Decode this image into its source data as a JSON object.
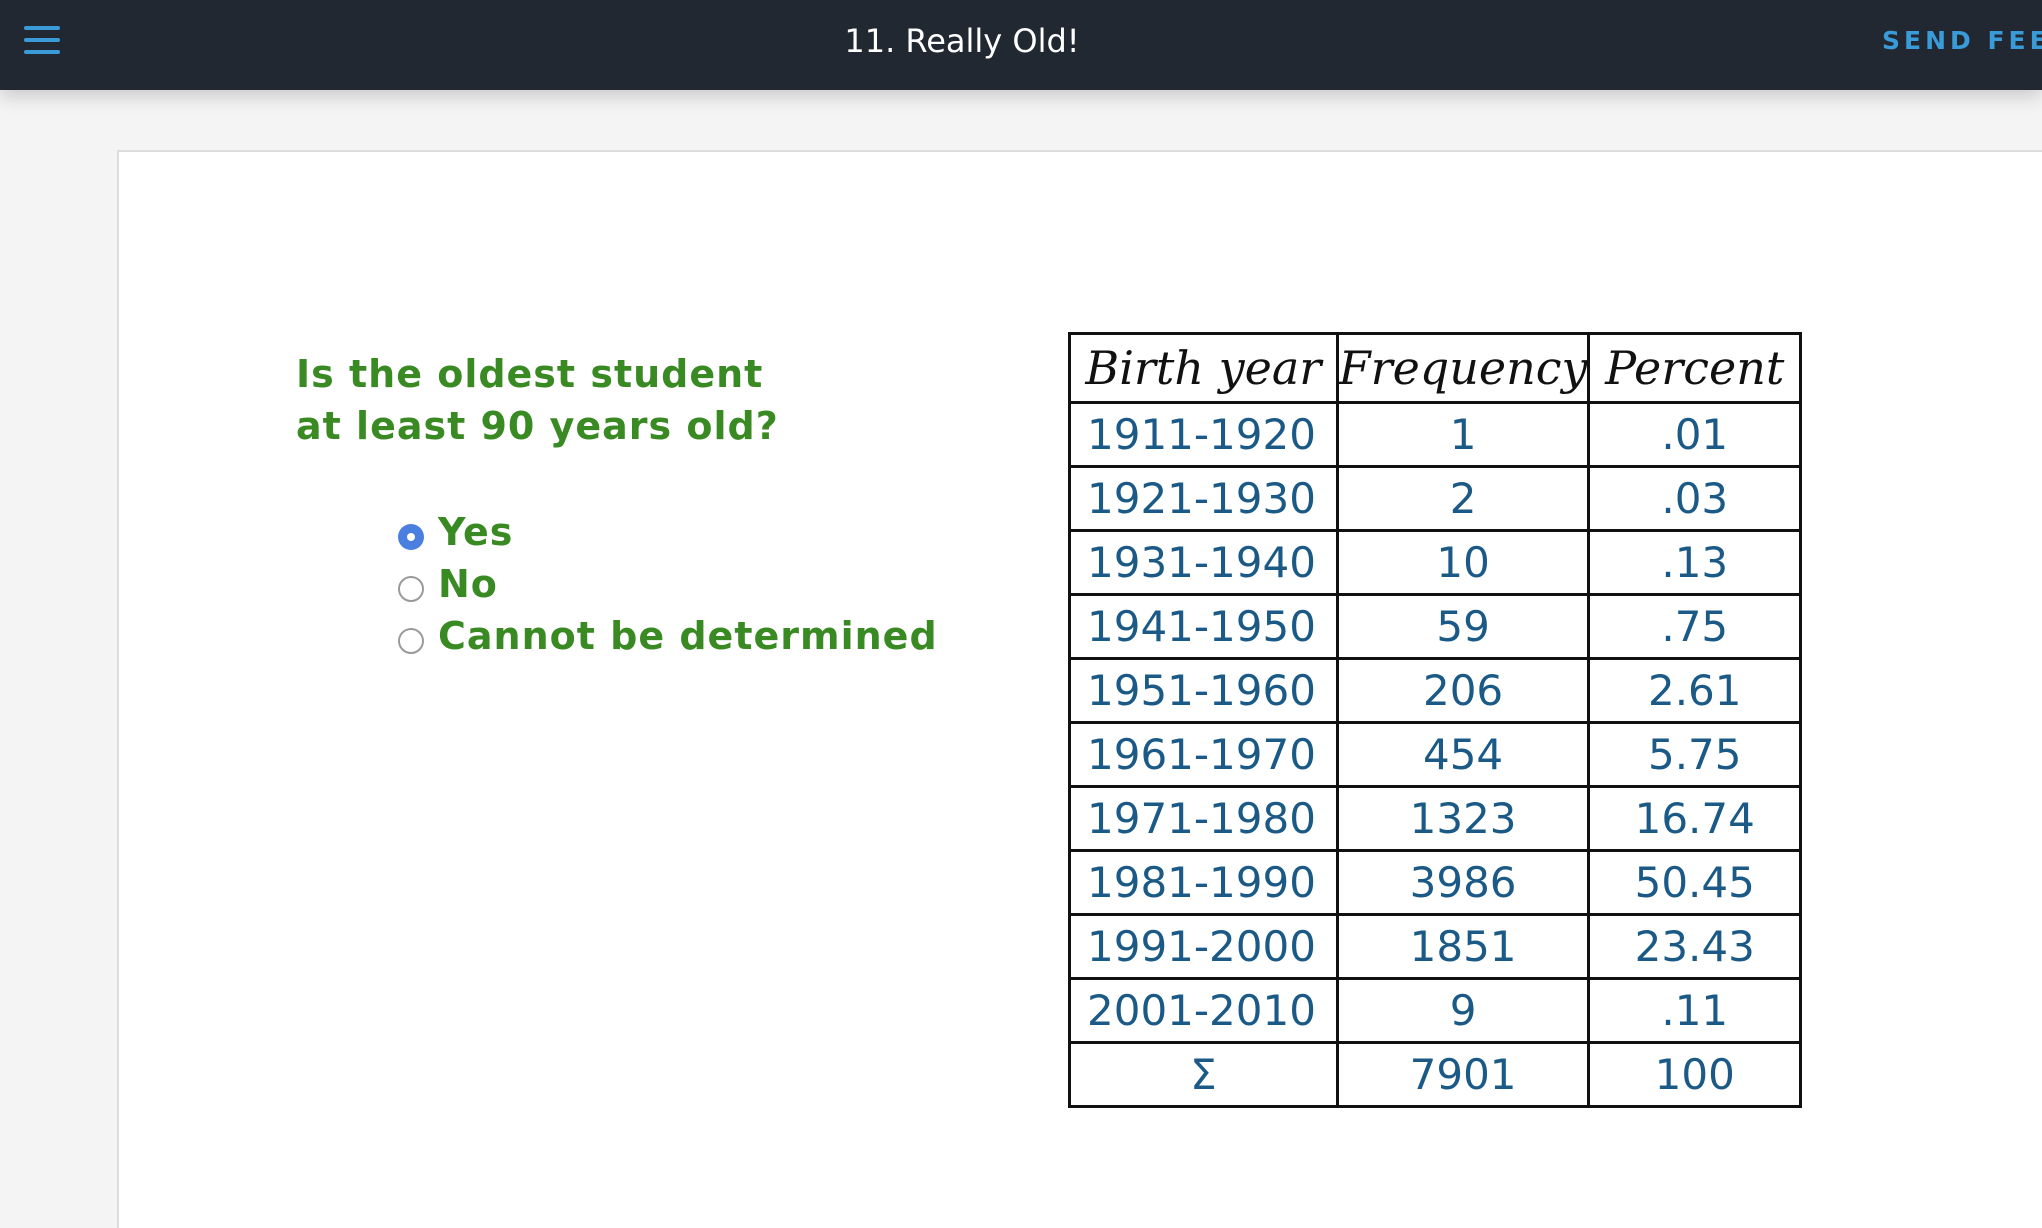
{
  "header": {
    "menu_icon": "hamburger-icon",
    "title": "11. Really Old!",
    "send_feedback_label": "SEND FEED",
    "accent_color": "#3a9bd9",
    "background_color": "#222831"
  },
  "question": {
    "line1": "Is the oldest student",
    "line2": "at least 90 years old?",
    "color": "#3a8a24",
    "options": [
      {
        "label": "Yes",
        "selected": true
      },
      {
        "label": "No",
        "selected": false
      },
      {
        "label": "Cannot be determined",
        "selected": false
      }
    ],
    "selected_color": "#4a7fe0"
  },
  "table": {
    "headers": [
      "Birth year",
      "Frequency",
      "Percent"
    ],
    "rows": [
      [
        "1911-1920",
        "1",
        ".01"
      ],
      [
        "1921-1930",
        "2",
        ".03"
      ],
      [
        "1931-1940",
        "10",
        ".13"
      ],
      [
        "1941-1950",
        "59",
        ".75"
      ],
      [
        "1951-1960",
        "206",
        "2.61"
      ],
      [
        "1961-1970",
        "454",
        "5.75"
      ],
      [
        "1971-1980",
        "1323",
        "16.74"
      ],
      [
        "1981-1990",
        "3986",
        "50.45"
      ],
      [
        "1991-2000",
        "1851",
        "23.43"
      ],
      [
        "2001-2010",
        "9",
        ".11"
      ],
      [
        "Σ",
        "7901",
        "100"
      ]
    ],
    "ink_color": "#1b5a86"
  }
}
